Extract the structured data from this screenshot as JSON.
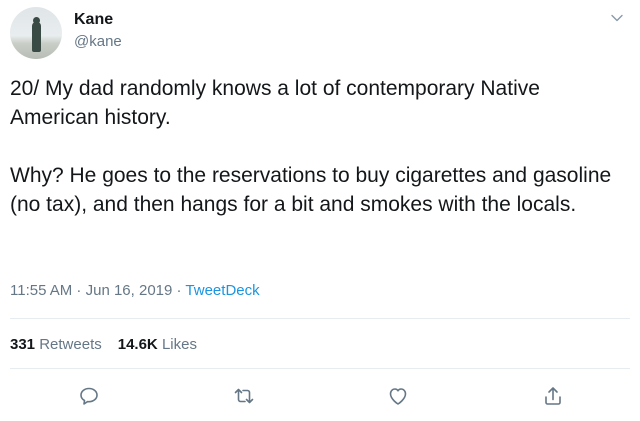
{
  "author": {
    "name": "Kane",
    "handle": "@kane"
  },
  "tweet": {
    "paragraph1": "20/ My dad randomly knows a lot of contemporary Native American history.",
    "paragraph2": "Why? He goes to the reservations to buy cigarettes and gasoline (no tax), and then hangs for a bit and smokes with the locals."
  },
  "meta": {
    "time": "11:55 AM",
    "separator1": " · ",
    "date": "Jun 16, 2019",
    "separator2": " · ",
    "source": "TweetDeck"
  },
  "stats": {
    "retweets_count": "331",
    "retweets_label": "Retweets",
    "likes_count": "14.6K",
    "likes_label": "Likes"
  },
  "actions": [
    {
      "name": "reply",
      "icon": "reply-icon"
    },
    {
      "name": "retweet",
      "icon": "retweet-icon"
    },
    {
      "name": "like",
      "icon": "heart-icon"
    },
    {
      "name": "share",
      "icon": "share-icon"
    }
  ],
  "colors": {
    "text": "#14171a",
    "secondary": "#657786",
    "link": "#1b95e0",
    "divider": "#e6ecf0"
  }
}
